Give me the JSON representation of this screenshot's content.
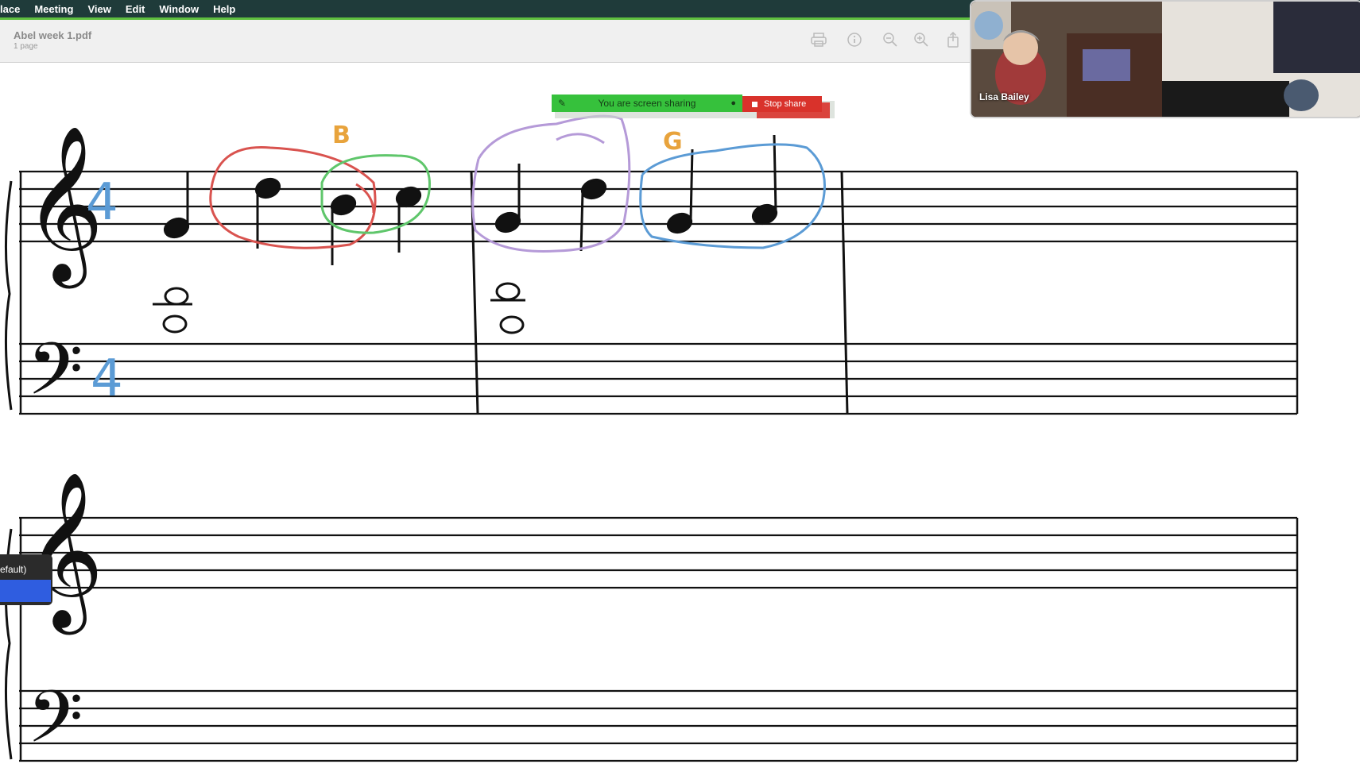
{
  "menubar": {
    "items": [
      "lace",
      "Meeting",
      "View",
      "Edit",
      "Window",
      "Help"
    ]
  },
  "document": {
    "title": "Abel week 1.pdf",
    "pages": "1 page"
  },
  "toolbar": {
    "icons": [
      "print-icon",
      "info-icon",
      "zoom-out-icon",
      "zoom-in-icon",
      "share-icon"
    ]
  },
  "screen_share": {
    "status": "You are screen sharing",
    "stop_label": "Stop share"
  },
  "video": {
    "participant": "Lisa Bailey"
  },
  "score": {
    "annotations": {
      "letter_b": "B",
      "letter_g": "G",
      "time_sig_treble": "4",
      "time_sig_bass": "4"
    }
  },
  "popup": {
    "text": "efault)"
  },
  "colors": {
    "menubar": "#1f3b3a",
    "share_green": "#36c13c",
    "stop_red": "#d9322b",
    "annot_red": "#d9534f",
    "annot_green": "#5fc66b",
    "annot_purple": "#b59ad8",
    "annot_blue": "#5b9bd5",
    "annot_orange": "#e8a33c"
  }
}
